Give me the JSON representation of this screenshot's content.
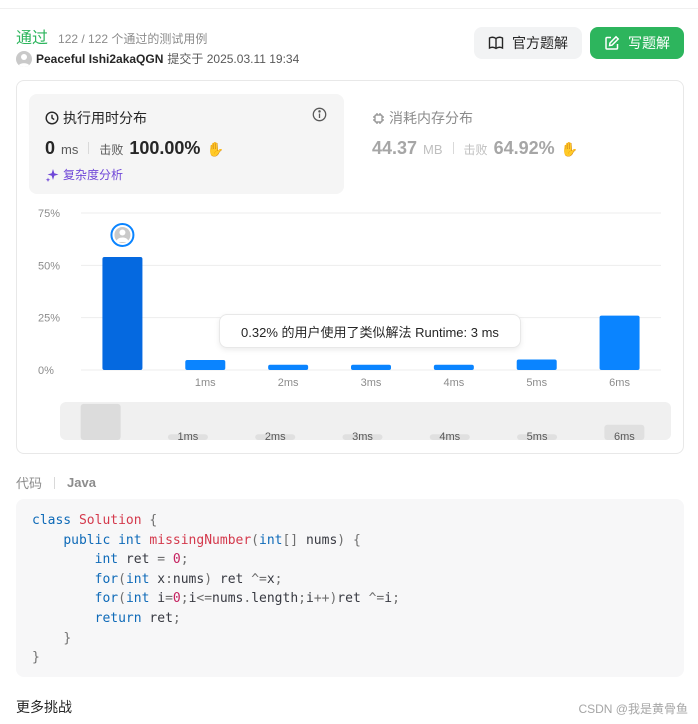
{
  "header": {
    "status": "通过",
    "tests": "122 / 122 个通过的测试用例",
    "user": "Peaceful Ishi2akaQGN",
    "submitted": "提交于 2025.03.11 19:34"
  },
  "buttons": {
    "official": "官方题解",
    "write": "写题解"
  },
  "runtime": {
    "title": "执行用时分布",
    "value": "0",
    "unit": "ms",
    "beats_label": "击败",
    "beats_value": "100.00%",
    "complexity": "复杂度分析"
  },
  "memory": {
    "title": "消耗内存分布",
    "value": "44.37",
    "unit": "MB",
    "beats_label": "击败",
    "beats_value": "64.92%"
  },
  "chart_data": {
    "type": "bar",
    "categories": [
      "0ms",
      "1ms",
      "2ms",
      "3ms",
      "4ms",
      "5ms",
      "6ms"
    ],
    "tick_labels": [
      "",
      "1ms",
      "2ms",
      "3ms",
      "4ms",
      "5ms",
      "6ms"
    ],
    "values": [
      54,
      4.8,
      2.5,
      2.5,
      2.5,
      5,
      26
    ],
    "y_ticks": [
      "0%",
      "25%",
      "50%",
      "75%"
    ],
    "ylim": [
      0,
      75
    ],
    "grid": true,
    "highlight_index": 0,
    "tooltip": "0.32% 的用户使用了类似解法 Runtime: 3 ms",
    "colors": {
      "bar": "#0a84ff",
      "bar_dark": "#0569e0",
      "grid": "#ededed",
      "axis_text": "#8c8c8c",
      "avatar_ring": "#0a84ff"
    }
  },
  "minimap": {
    "labels": [
      "",
      "1ms",
      "2ms",
      "3ms",
      "4ms",
      "5ms",
      "6ms"
    ],
    "heights": [
      0.95,
      0.15,
      0.15,
      0.15,
      0.15,
      0.15,
      0.4
    ]
  },
  "code": {
    "label": "代码",
    "language": "Java"
  },
  "more": "更多挑战",
  "watermark": "CSDN @我是黄骨鱼",
  "colors": {
    "accent": "#2db55d",
    "purple": "#6f47d8"
  }
}
